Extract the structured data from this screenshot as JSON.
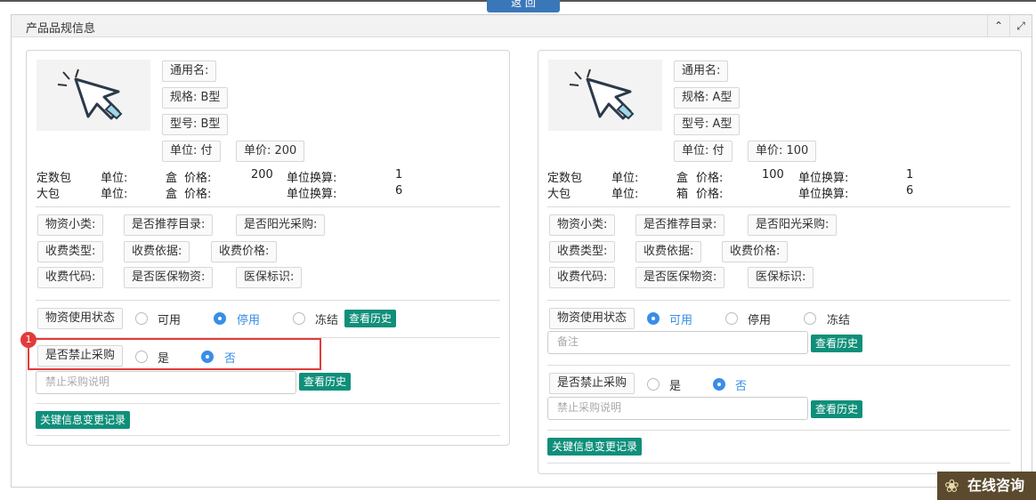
{
  "page": {
    "back_label": "返 回"
  },
  "panel": {
    "title": "产品品规信息",
    "collapse_icon": "chevron-up-icon",
    "expand_icon": "expand-icon"
  },
  "left": {
    "generic_name": "通用名:",
    "spec": "规格: B型",
    "model": "型号: B型",
    "unit": "单位: 付",
    "price": "单价: 200",
    "pack1": {
      "name": "定数包",
      "unit_label": "单位:",
      "unit": "盒",
      "price_label": "价格:",
      "price": "200",
      "conv_label": "单位换算:",
      "conv": "1"
    },
    "pack2": {
      "name": "大包",
      "unit_label": "单位:",
      "unit": "盒",
      "price_label": "价格:",
      "price": "",
      "conv_label": "单位换算:",
      "conv": "6"
    },
    "attrs": [
      "物资小类:",
      "是否推荐目录:",
      "是否阳光采购:",
      "收费类型:",
      "收费依据:",
      "收费价格:",
      "收费代码:",
      "是否医保物资:",
      "医保标识:"
    ],
    "status_label": "物资使用状态",
    "status_options": [
      "可用",
      "停用",
      "冻结"
    ],
    "status_selected": 1,
    "history_label": "查看历史",
    "ban_label": "是否禁止采购",
    "ban_options": [
      "是",
      "否"
    ],
    "ban_selected": 1,
    "ban_placeholder": "禁止采购说明",
    "ban_history_label": "查看历史",
    "change_log_label": "关键信息变更记录"
  },
  "right": {
    "generic_name": "通用名:",
    "spec": "规格: A型",
    "model": "型号: A型",
    "unit": "单位: 付",
    "price": "单价: 100",
    "pack1": {
      "name": "定数包",
      "unit_label": "单位:",
      "unit": "盒",
      "price_label": "价格:",
      "price": "100",
      "conv_label": "单位换算:",
      "conv": "1"
    },
    "pack2": {
      "name": "大包",
      "unit_label": "单位:",
      "unit": "箱",
      "price_label": "价格:",
      "price": "",
      "conv_label": "单位换算:",
      "conv": "6"
    },
    "attrs": [
      "物资小类:",
      "是否推荐目录:",
      "是否阳光采购:",
      "收费类型:",
      "收费依据:",
      "收费价格:",
      "收费代码:",
      "是否医保物资:",
      "医保标识:"
    ],
    "status_label": "物资使用状态",
    "status_options": [
      "可用",
      "停用",
      "冻结"
    ],
    "status_selected": 0,
    "note_placeholder": "备注",
    "history_label": "查看历史",
    "ban_label": "是否禁止采购",
    "ban_options": [
      "是",
      "否"
    ],
    "ban_selected": 1,
    "ban_placeholder": "禁止采购说明",
    "ban_history_label": "查看历史",
    "change_log_label": "关键信息变更记录"
  },
  "annotation": {
    "badge": "1",
    "color": "#e23b3b"
  },
  "widget": {
    "online_label": "在线咨询"
  },
  "colors": {
    "accent": "#3a8ee6",
    "button_green": "#0f8f7a",
    "back_blue": "#3a77b8"
  }
}
